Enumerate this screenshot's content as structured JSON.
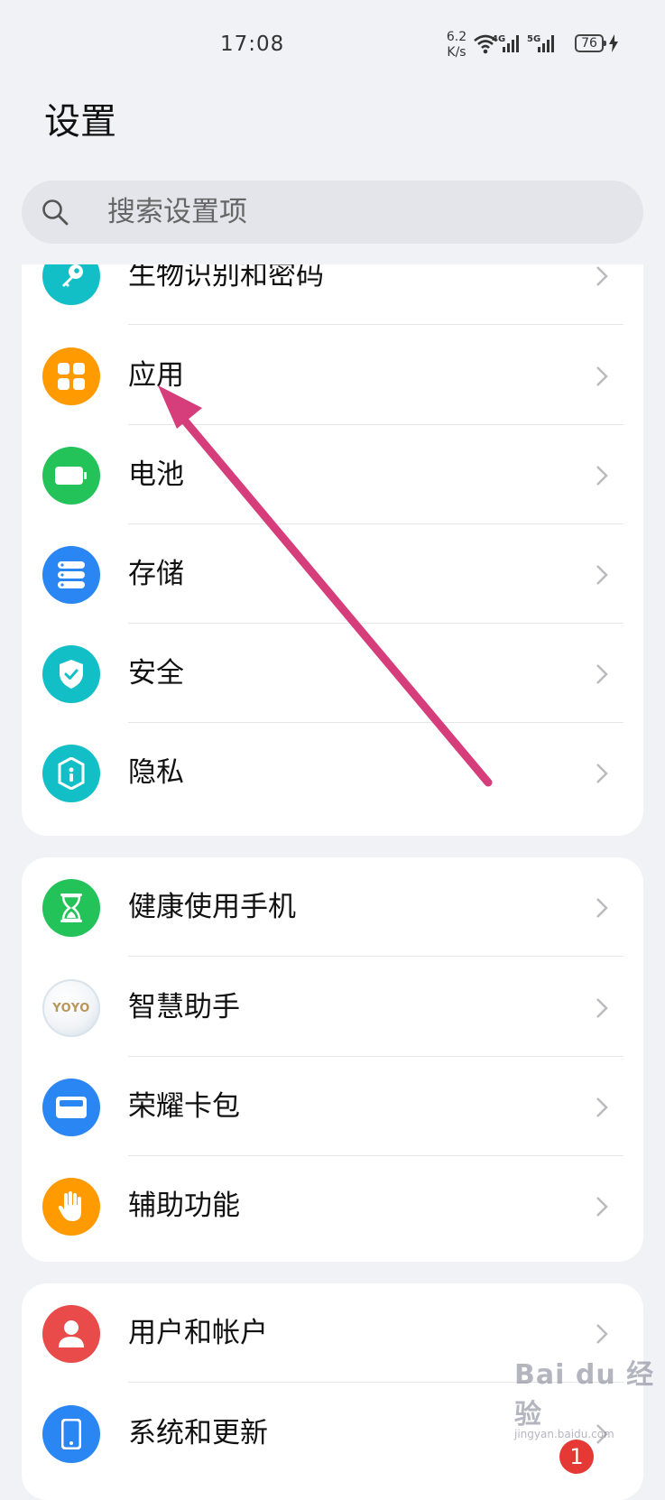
{
  "status_bar": {
    "time": "17:08",
    "net_speed_value": "6.2",
    "net_speed_unit": "K/s",
    "network_tag_1": "4G",
    "network_tag_2": "5G",
    "battery": "76"
  },
  "header": {
    "title": "设置"
  },
  "search": {
    "placeholder": "搜索设置项"
  },
  "groups": [
    {
      "items": [
        {
          "label": "生物识别和密码",
          "icon": "key-icon",
          "color": "#13bfc6"
        },
        {
          "label": "应用",
          "icon": "apps-grid-icon",
          "color": "#ff9a00"
        },
        {
          "label": "电池",
          "icon": "battery-icon",
          "color": "#23c35a"
        },
        {
          "label": "存储",
          "icon": "storage-icon",
          "color": "#2a86f3"
        },
        {
          "label": "安全",
          "icon": "shield-check-icon",
          "color": "#13bfc6"
        },
        {
          "label": "隐私",
          "icon": "privacy-lock-icon",
          "color": "#13bfc6"
        }
      ]
    },
    {
      "items": [
        {
          "label": "健康使用手机",
          "icon": "hourglass-icon",
          "color": "#23c35a"
        },
        {
          "label": "智慧助手",
          "icon": "yoyo-assistant-icon",
          "icon_text": "YOYO",
          "color": "#f0f4f7"
        },
        {
          "label": "荣耀卡包",
          "icon": "wallet-icon",
          "color": "#2a86f3"
        },
        {
          "label": "辅助功能",
          "icon": "hand-icon",
          "color": "#ff9a00"
        }
      ]
    },
    {
      "items": [
        {
          "label": "用户和帐户",
          "icon": "user-icon",
          "color": "#e94a4a"
        },
        {
          "label": "系统和更新",
          "icon": "phone-update-icon",
          "color": "#2a86f3",
          "badge": "1"
        }
      ]
    }
  ],
  "annotation": {
    "arrow_color": "#d63d7b"
  },
  "watermark": {
    "main": "Bai du 经验",
    "sub": "jingyan.baidu.com"
  }
}
